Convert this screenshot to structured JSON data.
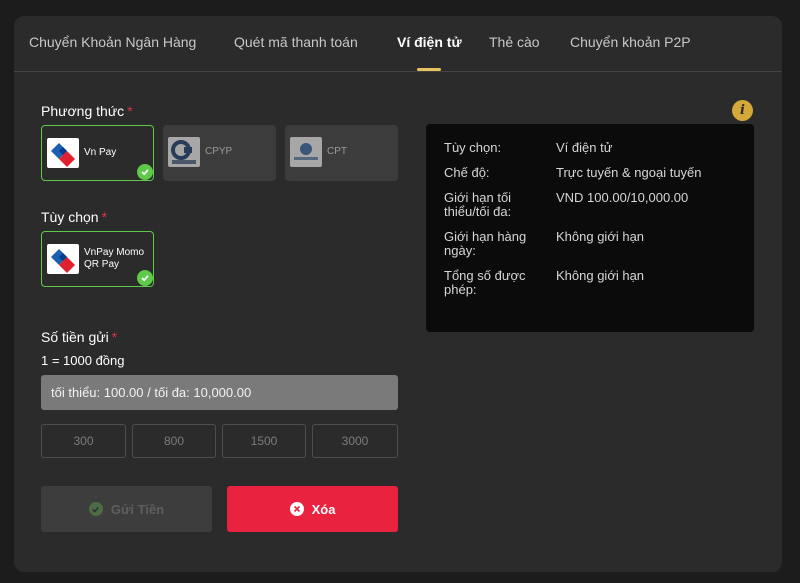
{
  "tabs": [
    {
      "label": "Chuyển Khoản Ngân Hàng",
      "active": false
    },
    {
      "label": "Quét mã thanh toán",
      "active": false
    },
    {
      "label": "Ví điện tử",
      "active": true
    },
    {
      "label": "Thẻ cào",
      "active": false
    },
    {
      "label": "Chuyển khoản P2P",
      "active": false
    }
  ],
  "method_section": {
    "label": "Phương thức",
    "required_mark": "*",
    "items": [
      {
        "label": "Vn Pay",
        "icon": "vnpay-logo",
        "selected": true
      },
      {
        "label": "CPYP",
        "icon": "cpyp-logo",
        "selected": false
      },
      {
        "label": "CPT",
        "icon": "cpt-logo",
        "selected": false
      }
    ]
  },
  "option_section": {
    "label": "Tùy chọn",
    "required_mark": "*",
    "items": [
      {
        "label_line1": "VnPay Momo",
        "label_line2": "QR Pay",
        "icon": "vnpay-logo",
        "selected": true
      }
    ]
  },
  "amount_section": {
    "label": "Số tiền gửi",
    "required_mark": "*",
    "rate": "1 = 1000 đồng",
    "placeholder": "tối thiểu: 100.00 / tối đa: 10,000.00",
    "value": "",
    "quick_amounts": [
      "300",
      "800",
      "1500",
      "3000"
    ]
  },
  "buttons": {
    "submit_label": "Gửi Tiền",
    "submit_enabled": false,
    "clear_label": "Xóa"
  },
  "info": {
    "rows": [
      {
        "key": "Tùy chọn:",
        "value": "Ví điện tử"
      },
      {
        "key": "Chế độ:",
        "value": "Trực tuyến & ngoại tuyến"
      },
      {
        "key": "Giới hạn tối thiểu/tối đa:",
        "value": "VND 100.00/10,000.00"
      },
      {
        "key": "Giới hạn hàng ngày:",
        "value": "Không giới hạn"
      },
      {
        "key": "Tổng số được phép:",
        "value": "Không giới hạn"
      }
    ],
    "icon": "info-icon"
  },
  "colors": {
    "accent": "#e8c25c",
    "selected_border": "#5fc94a",
    "danger": "#e8223f",
    "required": "#e0344a"
  }
}
